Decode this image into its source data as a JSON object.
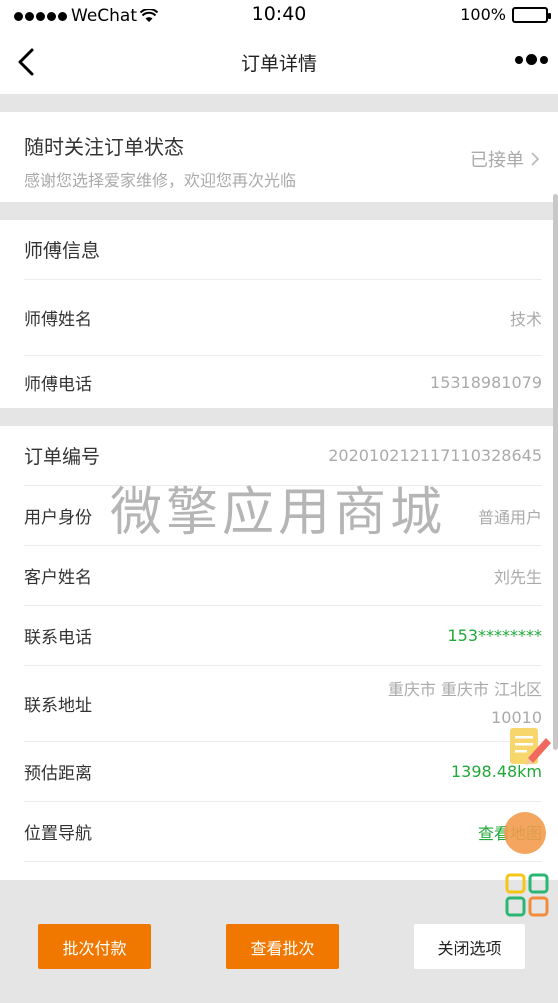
{
  "status_bar": {
    "carrier": "WeChat",
    "time": "10:40",
    "battery": "100%"
  },
  "nav": {
    "title": "订单详情"
  },
  "order_status": {
    "heading": "随时关注订单状态",
    "subtitle": "感谢您选择爱家维修，欢迎您再次光临",
    "status": "已接单"
  },
  "master": {
    "section_title": "师傅信息",
    "name_label": "师傅姓名",
    "name_value": "技术",
    "phone_label": "师傅电话",
    "phone_value": "15318981079"
  },
  "order": {
    "number_label": "订单编号",
    "number_value": "20201021211711032864​5",
    "identity_label": "用户身份",
    "identity_value": "普通用户",
    "customer_label": "客户姓名",
    "customer_value": "刘先生",
    "contact_label": "联系电话",
    "contact_value": "153********",
    "address_label": "联系地址",
    "address_line1": "重庆市 重庆市 江北区",
    "address_line2": "10010",
    "distance_label": "预估距离",
    "distance_value": "1398.48km",
    "nav_label": "位置导航",
    "nav_value": "查看地图"
  },
  "watermark": "微擎应用商城",
  "buttons": {
    "batch_pay": "批次付款",
    "view_batch": "查看批次",
    "close": "关闭选项"
  },
  "icons": {
    "back": "back-arrow-icon",
    "more": "more-dots-icon",
    "chevron": "chevron-right-icon",
    "note": "note-pencil-icon",
    "grid": "grid-apps-icon"
  },
  "colors": {
    "accent": "#f07800",
    "green": "#21a83a",
    "bg": "#e5e5e5"
  }
}
